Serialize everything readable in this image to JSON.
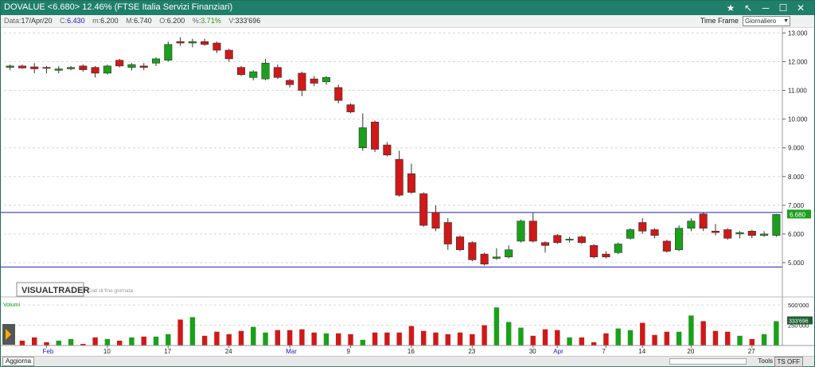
{
  "titlebar": {
    "title": "DOVALUE <6.680> 12.46%  (FTSE Italia Servizi Finanziari)",
    "icons": [
      "star-icon",
      "pin-icon",
      "minimize-icon",
      "maximize-icon",
      "close-icon"
    ],
    "color": "#1f7f6b"
  },
  "infobar": {
    "date_label": "Data:",
    "date": "17/Apr/20",
    "close_label": "C:",
    "close": "6.430",
    "min_label": "m:",
    "min": "6.200",
    "max_label": "M:",
    "max": "6.740",
    "open_label": "O:",
    "open": "6.200",
    "pct_label": "%:",
    "pct": "3.71%",
    "vol_label": "V:",
    "vol": "333'696",
    "timeframe_label": "Time Frame",
    "timeframe_value": "Giornaliero"
  },
  "watermark": {
    "brand": "VISUALTRADER",
    "note": "Dati di fine giornata"
  },
  "volume_panel": {
    "label": "Volumi",
    "last_volume": "333'696"
  },
  "bottombar": {
    "aggiorna": "Aggiorna",
    "tools": "Tools",
    "tsoff": "TS OFF"
  },
  "colors": {
    "up": "#1aa01a",
    "down": "#d01818",
    "hline": "#2020c0",
    "badge": "#1aa01a"
  },
  "chart_data": {
    "type": "candlestick",
    "y_range": [
      4.75,
      13.15
    ],
    "y_ticks": [
      "13.000",
      "12.000",
      "11.000",
      "10.000",
      "9.000",
      "8.000",
      "7.000",
      "6.000",
      "5.000"
    ],
    "y_tick_values": [
      13,
      12,
      11,
      10,
      9,
      8,
      7,
      6,
      5
    ],
    "last_price_badge": "6.680",
    "last_price": 6.68,
    "horizontal_lines": [
      6.75,
      4.85
    ],
    "x_tick_labels": [
      {
        "label": "Feb",
        "index": 3
      },
      {
        "label": "10",
        "index": 8
      },
      {
        "label": "17",
        "index": 13
      },
      {
        "label": "24",
        "index": 18
      },
      {
        "label": "Mar",
        "index": 23
      },
      {
        "label": "9",
        "index": 28
      },
      {
        "label": "16",
        "index": 33
      },
      {
        "label": "23",
        "index": 38
      },
      {
        "label": "30",
        "index": 43
      },
      {
        "label": "Apr",
        "index": 45
      },
      {
        "label": "7",
        "index": 49
      },
      {
        "label": "14",
        "index": 52
      },
      {
        "label": "20",
        "index": 56
      },
      {
        "label": "27",
        "index": 61
      }
    ],
    "volume_ticks": [
      "500'000",
      "250'000"
    ],
    "volume_tick_values": [
      500000,
      250000
    ],
    "volume_range": [
      0,
      560000
    ],
    "candles": [
      {
        "o": 11.8,
        "h": 11.9,
        "l": 11.7,
        "c": 11.85
      },
      {
        "o": 11.85,
        "h": 11.9,
        "l": 11.75,
        "c": 11.78
      },
      {
        "o": 11.82,
        "h": 11.95,
        "l": 11.6,
        "c": 11.75
      },
      {
        "o": 11.8,
        "h": 11.85,
        "l": 11.6,
        "c": 11.78
      },
      {
        "o": 11.7,
        "h": 11.85,
        "l": 11.6,
        "c": 11.75
      },
      {
        "o": 11.75,
        "h": 11.85,
        "l": 11.7,
        "c": 11.8
      },
      {
        "o": 11.85,
        "h": 11.9,
        "l": 11.65,
        "c": 11.72
      },
      {
        "o": 11.8,
        "h": 11.85,
        "l": 11.45,
        "c": 11.6
      },
      {
        "o": 11.6,
        "h": 11.9,
        "l": 11.55,
        "c": 11.85
      },
      {
        "o": 12.05,
        "h": 12.1,
        "l": 11.8,
        "c": 11.85
      },
      {
        "o": 11.8,
        "h": 11.95,
        "l": 11.7,
        "c": 11.9
      },
      {
        "o": 11.85,
        "h": 11.95,
        "l": 11.7,
        "c": 11.8
      },
      {
        "o": 11.95,
        "h": 12.15,
        "l": 11.85,
        "c": 12.1
      },
      {
        "o": 12.05,
        "h": 12.7,
        "l": 12.0,
        "c": 12.6
      },
      {
        "o": 12.7,
        "h": 12.85,
        "l": 12.55,
        "c": 12.65
      },
      {
        "o": 12.65,
        "h": 12.8,
        "l": 12.5,
        "c": 12.7
      },
      {
        "o": 12.7,
        "h": 12.8,
        "l": 12.55,
        "c": 12.6
      },
      {
        "o": 12.65,
        "h": 12.7,
        "l": 12.3,
        "c": 12.4
      },
      {
        "o": 12.4,
        "h": 12.45,
        "l": 12.0,
        "c": 12.1
      },
      {
        "o": 11.8,
        "h": 11.85,
        "l": 11.5,
        "c": 11.55
      },
      {
        "o": 11.45,
        "h": 11.7,
        "l": 11.35,
        "c": 11.65
      },
      {
        "o": 11.4,
        "h": 12.1,
        "l": 11.35,
        "c": 11.95
      },
      {
        "o": 11.8,
        "h": 11.9,
        "l": 11.4,
        "c": 11.45
      },
      {
        "o": 11.35,
        "h": 11.4,
        "l": 11.1,
        "c": 11.2
      },
      {
        "o": 11.6,
        "h": 11.65,
        "l": 10.8,
        "c": 11.0
      },
      {
        "o": 11.4,
        "h": 11.5,
        "l": 11.15,
        "c": 11.25
      },
      {
        "o": 11.3,
        "h": 11.5,
        "l": 11.2,
        "c": 11.45
      },
      {
        "o": 11.1,
        "h": 11.2,
        "l": 10.55,
        "c": 10.65
      },
      {
        "o": 10.5,
        "h": 10.55,
        "l": 10.2,
        "c": 10.25
      },
      {
        "o": 9.0,
        "h": 10.2,
        "l": 8.9,
        "c": 9.7
      },
      {
        "o": 9.9,
        "h": 9.95,
        "l": 8.85,
        "c": 8.95
      },
      {
        "o": 9.1,
        "h": 9.2,
        "l": 8.7,
        "c": 8.75
      },
      {
        "o": 8.6,
        "h": 8.9,
        "l": 7.3,
        "c": 7.35
      },
      {
        "o": 8.1,
        "h": 8.45,
        "l": 7.4,
        "c": 7.45
      },
      {
        "o": 7.4,
        "h": 7.45,
        "l": 6.25,
        "c": 6.3
      },
      {
        "o": 6.75,
        "h": 7.0,
        "l": 6.1,
        "c": 6.2
      },
      {
        "o": 6.4,
        "h": 6.55,
        "l": 5.45,
        "c": 5.65
      },
      {
        "o": 5.9,
        "h": 5.95,
        "l": 5.4,
        "c": 5.45
      },
      {
        "o": 5.7,
        "h": 5.75,
        "l": 5.05,
        "c": 5.1
      },
      {
        "o": 5.3,
        "h": 5.35,
        "l": 4.9,
        "c": 4.95
      },
      {
        "o": 5.15,
        "h": 5.5,
        "l": 5.1,
        "c": 5.2
      },
      {
        "o": 5.2,
        "h": 5.6,
        "l": 5.15,
        "c": 5.45
      },
      {
        "o": 5.75,
        "h": 6.5,
        "l": 5.7,
        "c": 6.45
      },
      {
        "o": 6.45,
        "h": 6.75,
        "l": 5.7,
        "c": 5.75
      },
      {
        "o": 5.7,
        "h": 5.75,
        "l": 5.35,
        "c": 5.6
      },
      {
        "o": 5.95,
        "h": 6.0,
        "l": 5.65,
        "c": 5.7
      },
      {
        "o": 5.8,
        "h": 5.9,
        "l": 5.7,
        "c": 5.82
      },
      {
        "o": 5.9,
        "h": 5.95,
        "l": 5.65,
        "c": 5.7
      },
      {
        "o": 5.6,
        "h": 5.65,
        "l": 5.15,
        "c": 5.2
      },
      {
        "o": 5.3,
        "h": 5.4,
        "l": 5.15,
        "c": 5.2
      },
      {
        "o": 5.35,
        "h": 5.7,
        "l": 5.3,
        "c": 5.65
      },
      {
        "o": 5.85,
        "h": 6.2,
        "l": 5.8,
        "c": 6.15
      },
      {
        "o": 6.4,
        "h": 6.55,
        "l": 6.0,
        "c": 6.1
      },
      {
        "o": 6.15,
        "h": 6.2,
        "l": 5.85,
        "c": 5.95
      },
      {
        "o": 5.75,
        "h": 5.8,
        "l": 5.35,
        "c": 5.4
      },
      {
        "o": 5.45,
        "h": 6.3,
        "l": 5.4,
        "c": 6.2
      },
      {
        "o": 6.2,
        "h": 6.55,
        "l": 6.1,
        "c": 6.45
      },
      {
        "o": 6.7,
        "h": 6.75,
        "l": 6.1,
        "c": 6.2
      },
      {
        "o": 6.1,
        "h": 6.35,
        "l": 5.95,
        "c": 6.05
      },
      {
        "o": 6.15,
        "h": 6.2,
        "l": 5.8,
        "c": 5.85
      },
      {
        "o": 6.0,
        "h": 6.1,
        "l": 5.85,
        "c": 6.05
      },
      {
        "o": 6.1,
        "h": 6.15,
        "l": 5.85,
        "c": 5.95
      },
      {
        "o": 5.95,
        "h": 6.1,
        "l": 5.9,
        "c": 6.0
      },
      {
        "o": 5.95,
        "h": 6.7,
        "l": 5.9,
        "c": 6.68
      }
    ],
    "volumes": [
      60000,
      100000,
      40000,
      60000,
      80000,
      20000,
      100000,
      80000,
      60000,
      100000,
      110000,
      110000,
      140000,
      320000,
      350000,
      120000,
      170000,
      140000,
      180000,
      230000,
      160000,
      190000,
      190000,
      200000,
      160000,
      150000,
      150000,
      140000,
      70000,
      160000,
      160000,
      160000,
      240000,
      180000,
      160000,
      140000,
      160000,
      140000,
      250000,
      470000,
      290000,
      220000,
      120000,
      200000,
      190000,
      100000,
      100000,
      40000,
      150000,
      210000,
      190000,
      280000,
      130000,
      170000,
      170000,
      370000,
      300000,
      180000,
      170000,
      120000,
      80000,
      140000,
      300000
    ]
  }
}
